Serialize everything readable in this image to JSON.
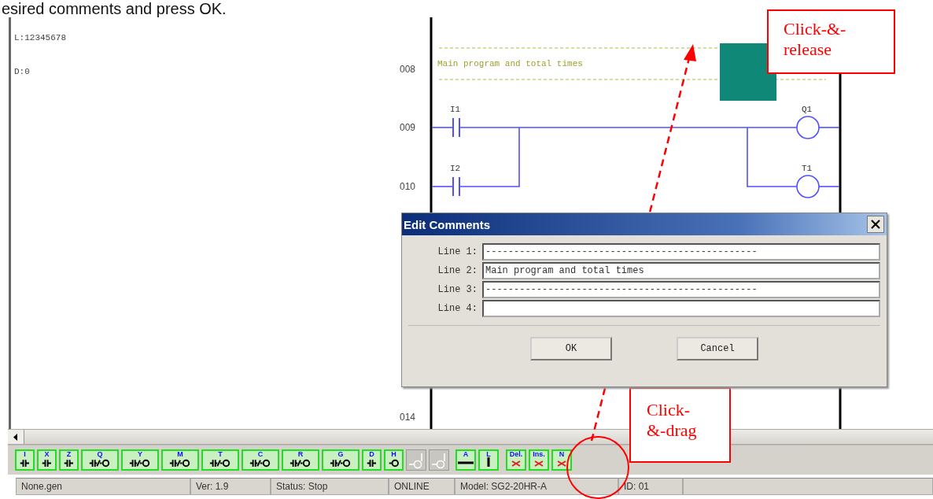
{
  "caption": "esired comments and press OK.",
  "left_panel": {
    "lines": [
      "L:12345678",
      "D:0"
    ]
  },
  "ladder": {
    "rungs": [
      {
        "number": "008",
        "kind": "comment",
        "comment": "Main program and total times",
        "highlighted": true
      },
      {
        "number": "009",
        "kind": "logic",
        "contact": "I1",
        "coil": "Q1"
      },
      {
        "number": "010",
        "kind": "parallel",
        "contact": "I2",
        "coil": "T1"
      },
      {
        "number": "014",
        "kind": "empty"
      }
    ]
  },
  "dialog": {
    "title": "Edit Comments",
    "fields": [
      {
        "label": "Line 1:",
        "value": "------------------------------------------------"
      },
      {
        "label": "Line 2:",
        "value": "Main program and total times"
      },
      {
        "label": "Line 3:",
        "value": "------------------------------------------------"
      },
      {
        "label": "Line 4:"
      }
    ],
    "buttons": [
      "OK",
      "Cancel"
    ]
  },
  "toolbar": [
    {
      "label": "I",
      "kind": "contact"
    },
    {
      "label": "X",
      "kind": "contact"
    },
    {
      "label": "Z",
      "kind": "contact"
    },
    {
      "label": "Q",
      "kind": "coil"
    },
    {
      "label": "Y",
      "kind": "coil"
    },
    {
      "label": "M",
      "kind": "coil"
    },
    {
      "label": "T",
      "kind": "coil"
    },
    {
      "label": "C",
      "kind": "coil"
    },
    {
      "label": "R",
      "kind": "coil"
    },
    {
      "label": "G",
      "kind": "coil"
    },
    {
      "label": "D",
      "kind": "contact"
    },
    {
      "label": "H",
      "kind": "output"
    },
    {
      "kind": "ghost"
    },
    {
      "kind": "ghost"
    },
    {
      "label": "A",
      "kind": "hline"
    },
    {
      "label": "L",
      "kind": "vline"
    },
    {
      "label": "Del.",
      "kind": "delete"
    },
    {
      "label": "Ins.",
      "kind": "insert"
    },
    {
      "label": "N",
      "kind": "note"
    }
  ],
  "status_bar": [
    "None.gen",
    "Ver: 1.9",
    "Status: Stop",
    "ONLINE",
    "Model: SG2-20HR-A",
    "ID: 01"
  ],
  "annotations": [
    {
      "text": "Click-&-release"
    },
    {
      "text": "Click-&-drag"
    }
  ]
}
